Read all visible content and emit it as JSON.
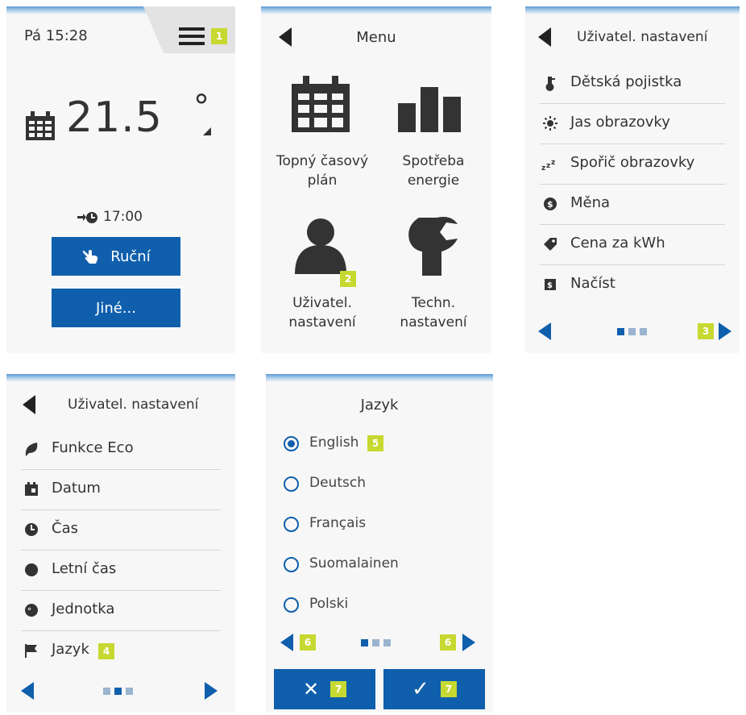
{
  "screen1": {
    "datetime": "Pá 15:28",
    "temperature": "21.5",
    "degree": "°",
    "next_time": "17:00",
    "manual_button": "Ruční",
    "other_button": "Jiné...",
    "badge_menu": "1"
  },
  "screen2": {
    "title": "Menu",
    "items": [
      {
        "label_l1": "Topný časový",
        "label_l2": "plán"
      },
      {
        "label_l1": "Spotřeba",
        "label_l2": "energie"
      },
      {
        "label_l1": "Uživatel.",
        "label_l2": "nastavení"
      },
      {
        "label_l1": "Techn.",
        "label_l2": "nastavení"
      }
    ],
    "badge_user": "2"
  },
  "screen3": {
    "title": "Uživatel. nastavení",
    "items": [
      "Dětská pojistka",
      "Jas obrazovky",
      "Spořič obrazovky",
      "Měna",
      "Cena za kWh",
      "Načíst"
    ],
    "badge_next": "3"
  },
  "screen4": {
    "title": "Uživatel. nastavení",
    "items": [
      "Funkce Eco",
      "Datum",
      "Čas",
      "Letní čas",
      "Jednotka",
      "Jazyk"
    ],
    "badge_language": "4"
  },
  "screen5": {
    "title": "Jazyk",
    "options": [
      "English",
      "Deutsch",
      "Français",
      "Suomalainen",
      "Polski"
    ],
    "selected": "English",
    "badge_english": "5",
    "badge_prev": "6",
    "badge_next": "6",
    "badge_cancel": "7",
    "badge_confirm": "7",
    "cancel_symbol": "✕",
    "confirm_symbol": "✓"
  },
  "colors": {
    "accent_blue": "#0f5fac",
    "badge_green": "#c7d931",
    "panel_bg": "#f7f7f7",
    "text": "#333333"
  },
  "icons": {
    "menu": "hamburger-icon",
    "calendar": "calendar-icon",
    "clock_arrow": "next-event-icon",
    "hand": "hand-icon",
    "back": "back-arrow-icon",
    "chart": "bar-chart-icon",
    "user": "user-icon",
    "wrench": "wrench-icon"
  }
}
